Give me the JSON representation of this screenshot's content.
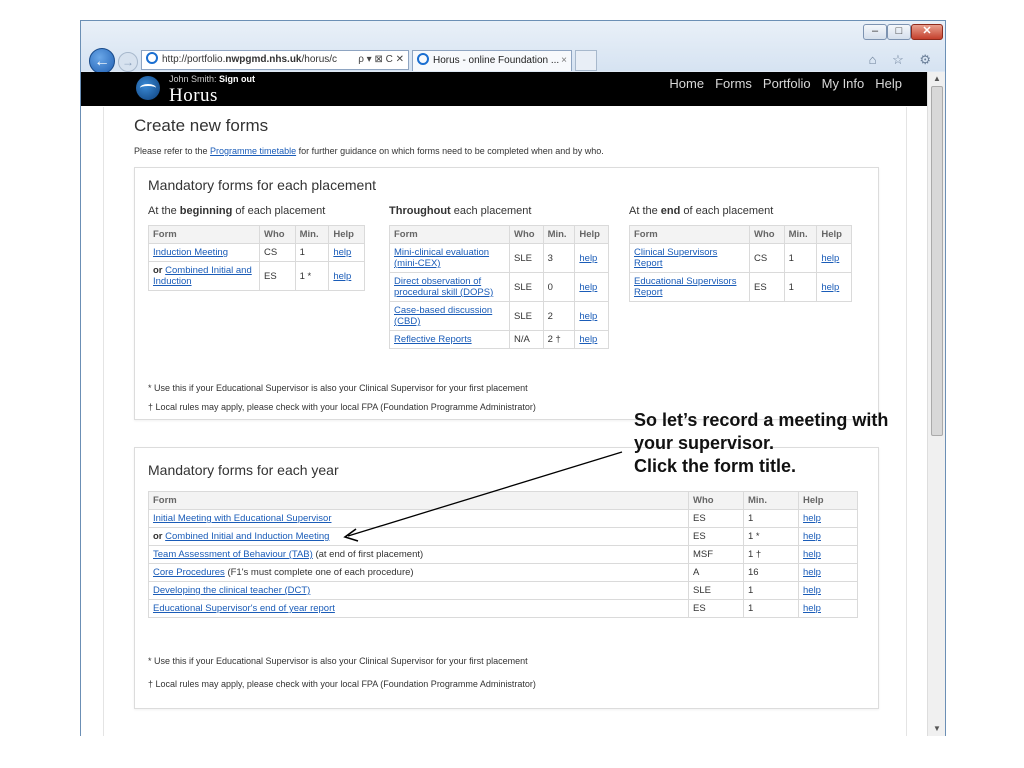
{
  "browser": {
    "address": {
      "prefix": "http://portfolio.",
      "domain": "nwpgmd.nhs.uk",
      "suffix": "/horus/c",
      "tools": "ρ ▾ ⊠ C ✕"
    },
    "tab": {
      "title": "Horus - online Foundation ...",
      "close": "×"
    },
    "window_controls": {
      "minimize": "–",
      "maximize": "□",
      "close": "✕"
    },
    "tools": "⌂ ☆ ⚙"
  },
  "header": {
    "user_name": "John Smith:",
    "sign_out": "Sign out",
    "brand": "Horus",
    "nav": [
      "Home",
      "Forms",
      "Portfolio",
      "My Info",
      "Help"
    ]
  },
  "page": {
    "title": "Create new forms",
    "intro_before": "Please refer to the ",
    "intro_link": "Programme timetable",
    "intro_after": " for further guidance on which forms need to be completed when and by who."
  },
  "placement": {
    "title": "Mandatory forms for each placement",
    "beginning_head": {
      "pre": "At the ",
      "bold": "beginning",
      "post": " of each placement"
    },
    "throughout_head": {
      "bold": "Throughout",
      "post": " each placement"
    },
    "end_head": {
      "pre": "At the ",
      "bold": "end",
      "post": " of each placement"
    },
    "headers": {
      "form": "Form",
      "who": "Who",
      "min": "Min.",
      "help": "Help"
    },
    "beginning_rows": [
      {
        "prefix": "",
        "form": "Induction Meeting",
        "who": "CS",
        "min": "1",
        "help": "help"
      },
      {
        "prefix": "or ",
        "form": "Combined Initial and Induction",
        "who": "ES",
        "min": "1 *",
        "help": "help"
      }
    ],
    "throughout_rows": [
      {
        "form": "Mini-clinical evaluation (mini-CEX)",
        "who": "SLE",
        "min": "3",
        "help": "help"
      },
      {
        "form": "Direct observation of procedural skill (DOPS)",
        "who": "SLE",
        "min": "0",
        "help": "help"
      },
      {
        "form": "Case-based discussion (CBD)",
        "who": "SLE",
        "min": "2",
        "help": "help"
      },
      {
        "form": "Reflective Reports",
        "who": "N/A",
        "min": "2 †",
        "help": "help"
      }
    ],
    "end_rows": [
      {
        "form": "Clinical Supervisors Report",
        "who": "CS",
        "min": "1",
        "help": "help"
      },
      {
        "form": "Educational Supervisors Report",
        "who": "ES",
        "min": "1",
        "help": "help"
      }
    ],
    "note1": "* Use this if your Educational Supervisor is also your Clinical Supervisor for your first placement",
    "note2": "† Local rules may apply, please check with your local FPA (Foundation Programme Administrator)"
  },
  "year": {
    "title": "Mandatory forms for each year",
    "headers": {
      "form": "Form",
      "who": "Who",
      "min": "Min.",
      "help": "Help"
    },
    "rows": [
      {
        "prefix": "",
        "form": "Initial Meeting with Educational Supervisor",
        "suffix": "",
        "who": "ES",
        "min": "1",
        "help": "help"
      },
      {
        "prefix": "or ",
        "form": "Combined Initial and Induction Meeting",
        "suffix": "",
        "who": "ES",
        "min": "1 *",
        "help": "help"
      },
      {
        "prefix": "",
        "form": "Team Assessment of Behaviour (TAB)",
        "suffix": " (at end of first placement)",
        "who": "MSF",
        "min": "1 †",
        "help": "help"
      },
      {
        "prefix": "",
        "form": "Core Procedures",
        "suffix": " (F1's must complete one of each procedure)",
        "who": "A",
        "min": "16",
        "help": "help"
      },
      {
        "prefix": "",
        "form": "Developing the clinical teacher (DCT)",
        "suffix": "",
        "who": "SLE",
        "min": "1",
        "help": "help"
      },
      {
        "prefix": "",
        "form": "Educational Supervisor's end of year report",
        "suffix": "",
        "who": "ES",
        "min": "1",
        "help": "help"
      }
    ],
    "note1": "* Use this if your Educational Supervisor is also your Clinical Supervisor for your first placement",
    "note2": "† Local rules may apply, please check with your local FPA (Foundation Programme Administrator)"
  },
  "annotation": {
    "line1": "So let’s record a meeting with",
    "line2": "your supervisor.",
    "line3": "Click the form title."
  }
}
